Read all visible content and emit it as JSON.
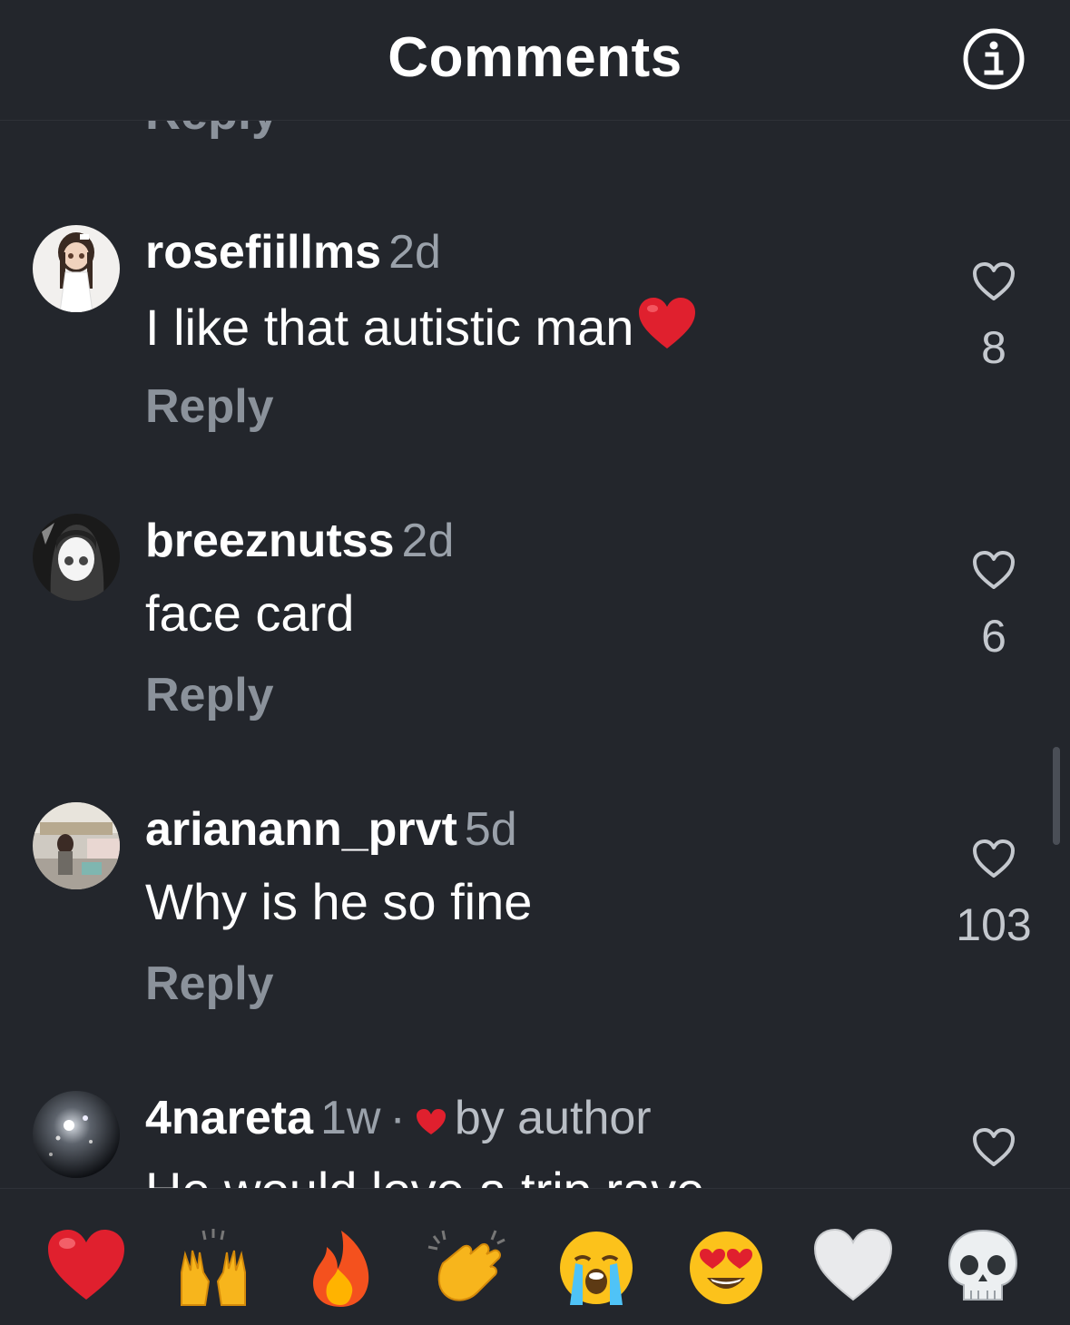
{
  "header": {
    "title": "Comments"
  },
  "partial_reply_label": "Reply",
  "comments": [
    {
      "username": "rosefiillms",
      "time": "2d",
      "text": "I like that autistic man",
      "has_heart_emoji": true,
      "reply_label": "Reply",
      "likes": "8",
      "avatar": "doll-avatar"
    },
    {
      "username": "breeznutss",
      "time": "2d",
      "text": "face card",
      "reply_label": "Reply",
      "likes": "6",
      "avatar": "anime-girl-avatar"
    },
    {
      "username": "arianann_prvt",
      "time": "5d",
      "text": "Why is he so fine",
      "reply_label": "Reply",
      "likes": "103",
      "avatar": "store-photo-avatar"
    },
    {
      "username": "4nareta",
      "time": "1w",
      "dot": "·",
      "author_tag": "by author",
      "text": "He would love a trip rave",
      "avatar": "sparkle-dark-avatar"
    }
  ],
  "emoji_bar": [
    "red-heart",
    "raising-hands",
    "fire",
    "clapping-hands",
    "loudly-crying-face",
    "heart-eyes-face",
    "white-heart",
    "skull"
  ],
  "colors": {
    "background": "#23262c",
    "secondary_text": "#8b929b",
    "accent_red": "#e0202e"
  }
}
